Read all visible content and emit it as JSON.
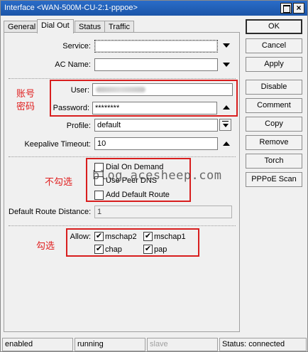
{
  "window": {
    "title": "Interface <WAN-500M-CU-2:1-pppoe>"
  },
  "tabs": [
    "General",
    "Dial Out",
    "Status",
    "Traffic"
  ],
  "form": {
    "service_label": "Service:",
    "service_value": "",
    "ac_name_label": "AC Name:",
    "ac_name_value": "",
    "user_label": "User:",
    "password_label": "Password:",
    "password_value": "********",
    "profile_label": "Profile:",
    "profile_value": "default",
    "keepalive_label": "Keepalive Timeout:",
    "keepalive_value": "10",
    "dial_on_demand": "Dial On Demand",
    "use_peer_dns": "Use Peer DNS",
    "add_default_route": "Add Default Route",
    "default_route_distance_label": "Default Route Distance:",
    "default_route_distance_value": "1",
    "allow_label": "Allow:",
    "mschap2": "mschap2",
    "mschap1": "mschap1",
    "chap": "chap",
    "pap": "pap",
    "check_mark": "✔"
  },
  "annotations": {
    "account": "账号",
    "password": "密码",
    "unchecked": "不勾选",
    "checked": "勾选"
  },
  "watermark": "blog.acesheep.com",
  "buttons": [
    "OK",
    "Cancel",
    "Apply",
    "Disable",
    "Comment",
    "Copy",
    "Remove",
    "Torch",
    "PPPoE Scan"
  ],
  "status": {
    "enabled": "enabled",
    "running": "running",
    "slave": "slave",
    "connection": "Status: connected"
  },
  "colors": {
    "titlebar": "#1b55a8",
    "annotation": "#d81e1e"
  }
}
